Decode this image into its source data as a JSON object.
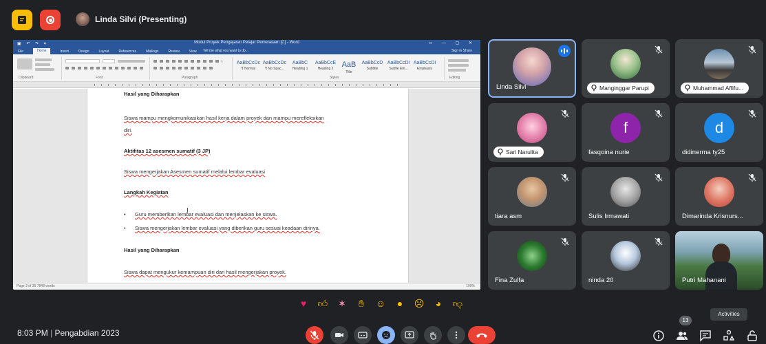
{
  "meet": {
    "presenter_label": "Linda Silvi (Presenting)",
    "clock": "8:03 PM",
    "separator": "|",
    "meeting_name": "Pengabdian 2023",
    "participant_count": "13",
    "tooltip": "Activities"
  },
  "word": {
    "title": "Modul Proyek Pengajaran Pelajar Pemerataan [C] - Word",
    "tabs": [
      "File",
      "Home",
      "Insert",
      "Design",
      "Layout",
      "References",
      "Mailings",
      "Review",
      "View"
    ],
    "tell_me": "Tell me what you want to do...",
    "sign_in": "Sign in   Share",
    "groups": [
      "Clipboard",
      "Font",
      "Paragraph",
      "Styles",
      "Editing"
    ],
    "styles": [
      {
        "sample": "AaBbCcDc",
        "label": "¶ Normal"
      },
      {
        "sample": "AaBbCcDc",
        "label": "¶ No Spac..."
      },
      {
        "sample": "AaBbC",
        "label": "Heading 1"
      },
      {
        "sample": "AaBbCcE",
        "label": "Heading 2"
      },
      {
        "sample": "AaB",
        "label": "Title"
      },
      {
        "sample": "AaBbCcD",
        "label": "Subtitle"
      },
      {
        "sample": "AaBbCcDi",
        "label": "Subtle Em..."
      },
      {
        "sample": "AaBbCcDi",
        "label": "Emphasis"
      }
    ],
    "status_left": "Page 3 of 35   7848 words",
    "status_right": "100%",
    "doc": {
      "h1": "Hasil yang Diharapkan",
      "p1a": "Siswa mampu mengkomunikasikan hasil kerja dalam proyek dan mampu merefleksikan",
      "p1b": "diri.",
      "h2": "Aktifitas 12 asesmen sumatif (3 JP)",
      "cursor": "I",
      "p2": "Siswa mengerjakan Asesmen sumatif melalui lembar evaluasi",
      "h3": "Langkah Kegiatan",
      "b1": "Guru memberikan lembar evaluasi dan menjelaskan ke siswa.",
      "b2": "Siswa mengerjakan lembar evaluasi yang diberikan guru sesuai keadaan dirinya.",
      "h4": "Hasil yang Diharapkan",
      "p3": "Siswa dapat mengukur kemampuan diri dari hasil mengerjakan proyek."
    }
  },
  "participants": [
    {
      "name": "Linda Silvi",
      "avatar": "photo",
      "speaking": true
    },
    {
      "name": "Manginggar Parupi",
      "avatar": "photo",
      "pinned": true
    },
    {
      "name": "Muhammad Affifu...",
      "avatar": "photo",
      "pinned": true
    },
    {
      "name": "Sari Narulita",
      "avatar": "photo",
      "pinned": true
    },
    {
      "name": "fasqoina nurie",
      "avatar_letter": "f"
    },
    {
      "name": "didinerma ty25",
      "avatar_letter": "d"
    },
    {
      "name": "tiara asm",
      "avatar": "photo"
    },
    {
      "name": "Sulis Irmawati",
      "avatar": "photo"
    },
    {
      "name": "Dimarinda Krisnurs...",
      "avatar": "photo"
    },
    {
      "name": "Fina Zulfa",
      "avatar": "photo"
    },
    {
      "name": "ninda 20",
      "avatar": "photo"
    },
    {
      "name": "Putri Mahanani",
      "avatar": "video"
    }
  ],
  "reactions": [
    "heart",
    "thumbs-up",
    "party",
    "clap",
    "laugh",
    "surprised",
    "sad",
    "thinking",
    "thumbs-down"
  ],
  "colors": {
    "bg": "#202124",
    "tile": "#3c4043",
    "red": "#ea4335",
    "blue": "#8ab4f8",
    "word_blue": "#2b579a"
  }
}
